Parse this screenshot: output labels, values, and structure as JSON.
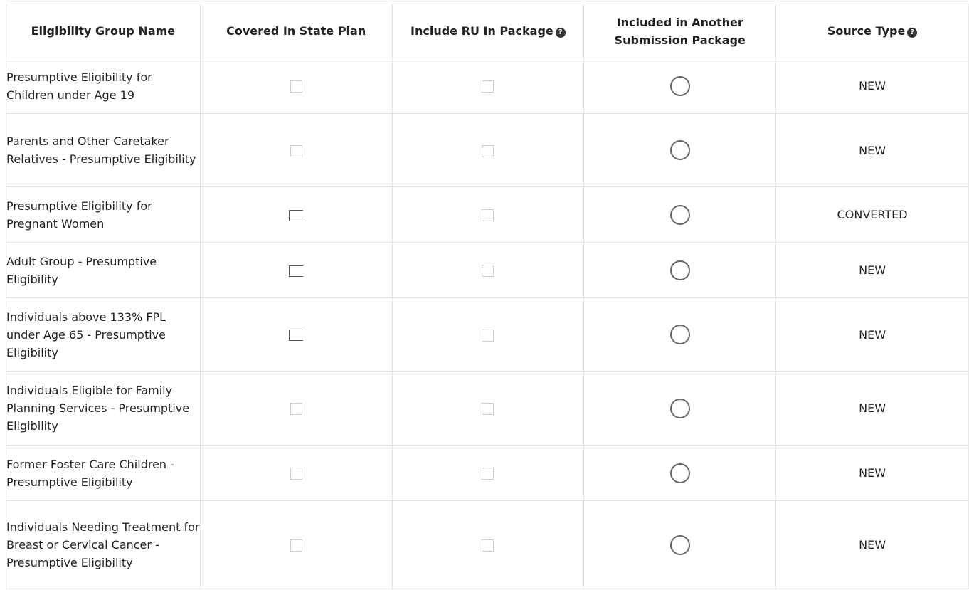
{
  "table": {
    "headers": {
      "name": "Eligibility Group Name",
      "covered": "Covered In State Plan",
      "include_ru": "Include RU In Package",
      "included_other": "Included in Another Submission Package",
      "source_type": "Source Type"
    },
    "rows": [
      {
        "name": "Presumptive Eligibility for Children under Age 19",
        "covered_state": "unchecked",
        "source_type": "NEW"
      },
      {
        "name": "Parents and Other Caretaker Relatives - Presumptive Eligibility",
        "covered_state": "unchecked",
        "source_type": "NEW"
      },
      {
        "name": "Presumptive Eligibility for Pregnant Women",
        "covered_state": "partial",
        "source_type": "CONVERTED"
      },
      {
        "name": "Adult Group - Presumptive Eligibility",
        "covered_state": "partial",
        "source_type": "NEW"
      },
      {
        "name": "Individuals above 133% FPL under Age 65 - Presumptive Eligibility",
        "covered_state": "partial",
        "source_type": "NEW"
      },
      {
        "name": "Individuals Eligible for Family Planning Services - Presumptive Eligibility",
        "covered_state": "unchecked",
        "source_type": "NEW"
      },
      {
        "name": "Former Foster Care Children - Presumptive Eligibility",
        "covered_state": "unchecked",
        "source_type": "NEW"
      },
      {
        "name": "Individuals Needing Treatment for Breast or Cervical Cancer - Presumptive Eligibility",
        "covered_state": "unchecked",
        "source_type": "NEW"
      }
    ]
  }
}
